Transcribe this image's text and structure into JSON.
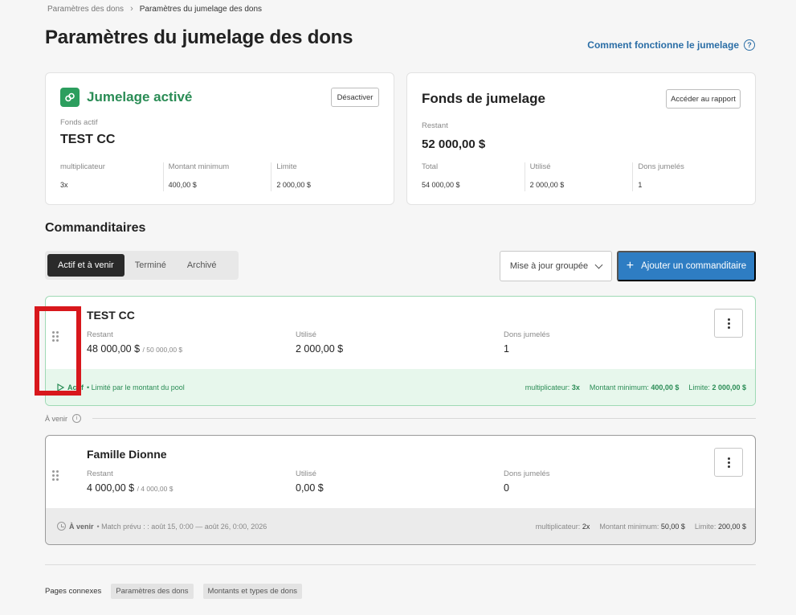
{
  "breadcrumb": {
    "parent": "Paramètres des dons",
    "separator": "›",
    "current": "Paramètres du jumelage des dons"
  },
  "page_title": "Paramètres du jumelage des dons",
  "help_link": {
    "label": "Comment fonctionne le jumelage",
    "icon": "question-circle-icon"
  },
  "matching_card": {
    "status_title": "Jumelage activé",
    "status_icon": "link-icon",
    "deactivate_label": "Désactiver",
    "fund_label": "Fonds actif",
    "fund_name": "TEST CC",
    "stats": [
      {
        "label": "multiplicateur",
        "value": "3x"
      },
      {
        "label": "Montant minimum",
        "value": "400,00 $"
      },
      {
        "label": "Limite",
        "value": "2 000,00 $"
      }
    ]
  },
  "fund_card": {
    "title": "Fonds de jumelage",
    "report_label": "Accéder au rapport",
    "remaining_label": "Restant",
    "remaining_value": "52 000,00 $",
    "stats": [
      {
        "label": "Total",
        "value": "54 000,00 $"
      },
      {
        "label": "Utilisé",
        "value": "2 000,00 $"
      },
      {
        "label": "Dons jumelés",
        "value": "1"
      }
    ]
  },
  "sponsors_section": {
    "title": "Commanditaires",
    "tabs": [
      "Actif et à venir",
      "Terminé",
      "Archivé"
    ],
    "active_tab": 0,
    "bulk_update_label": "Mise à jour groupée",
    "add_label": "Ajouter un commanditaire"
  },
  "columns": {
    "remaining": "Restant",
    "used": "Utilisé",
    "matched": "Dons jumelés"
  },
  "sponsors": [
    {
      "name": "TEST CC",
      "remaining": "48 000,00 $",
      "remaining_total": "/ 50 000,00 $",
      "used": "2 000,00 $",
      "matched": "1",
      "status": "Actif",
      "status_detail": "• Limité par le montant du pool",
      "multiplier_label": "multiplicateur:",
      "multiplier": "3x",
      "minimum_label": "Montant minimum:",
      "minimum": "400,00 $",
      "limit_label": "Limite:",
      "limit": "2 000,00 $"
    },
    {
      "name": "Famille Dionne",
      "remaining": "4 000,00 $",
      "remaining_total": "/ 4 000,00 $",
      "used": "0,00 $",
      "matched": "0",
      "status": "À venir",
      "status_detail": "• Match prévu : : août 15, 0:00 — août 26, 0:00, 2026",
      "multiplier_label": "multiplicateur:",
      "multiplier": "2x",
      "minimum_label": "Montant minimum:",
      "minimum": "50,00 $",
      "limit_label": "Limite:",
      "limit": "200,00 $"
    }
  ],
  "upcoming_divider": {
    "label": "À venir",
    "icon": "info-icon"
  },
  "related_pages": {
    "label": "Pages connexes",
    "links": [
      "Paramètres des dons",
      "Montants et types de dons"
    ]
  },
  "colors": {
    "accent_green": "#2a8c55",
    "primary_blue": "#2e7dc3",
    "highlight_red": "#d8171c"
  }
}
